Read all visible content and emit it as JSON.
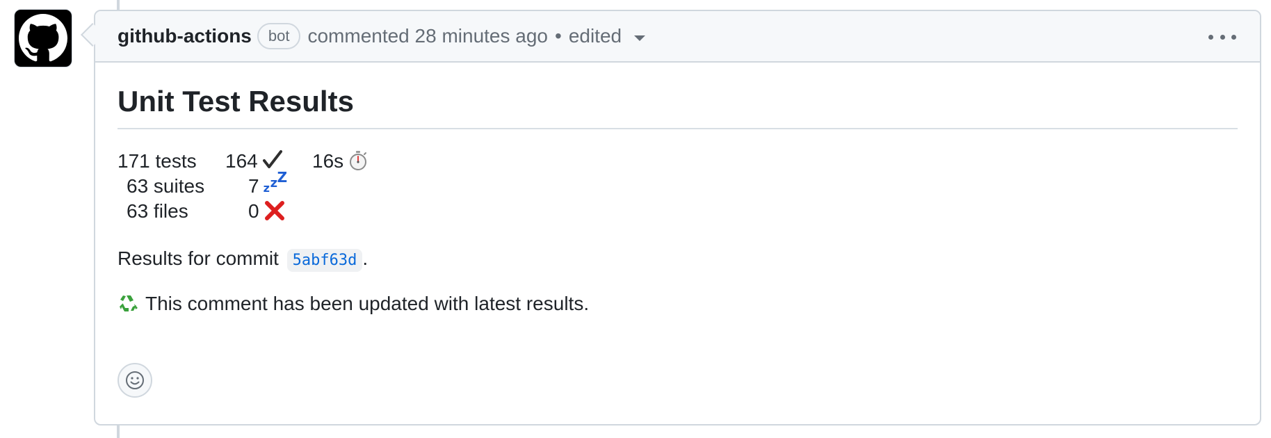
{
  "comment": {
    "author": "github-actions",
    "author_badge": "bot",
    "action": "commented 28 minutes ago",
    "separator": "•",
    "edited_label": "edited",
    "more_options_icon": "kebab-horizontal-icon"
  },
  "body": {
    "title": "Unit Test Results",
    "stats": {
      "tests": "171 tests",
      "suites": "63 suites",
      "files": "63 files",
      "passed": "164",
      "skipped": "7",
      "failed": "0",
      "duration": "16s"
    },
    "results_prefix": "Results for commit",
    "commit_sha": "5abf63d",
    "results_suffix": ".",
    "update_note": "This comment has been updated with latest results."
  },
  "icons": {
    "avatar": "github-octocat-icon",
    "passed": "check-icon",
    "skipped": "zzz-icon",
    "failed": "x-icon",
    "duration": "stopwatch-icon",
    "update": "recycle-icon",
    "reaction": "smiley-icon"
  },
  "colors": {
    "link": "#0969da",
    "border": "#d0d7de",
    "header_bg": "#f6f8fa",
    "muted_text": "#656d76",
    "failed": "#dd1f1f",
    "skipped": "#1f5fd4",
    "recycle": "#3aa13c"
  }
}
